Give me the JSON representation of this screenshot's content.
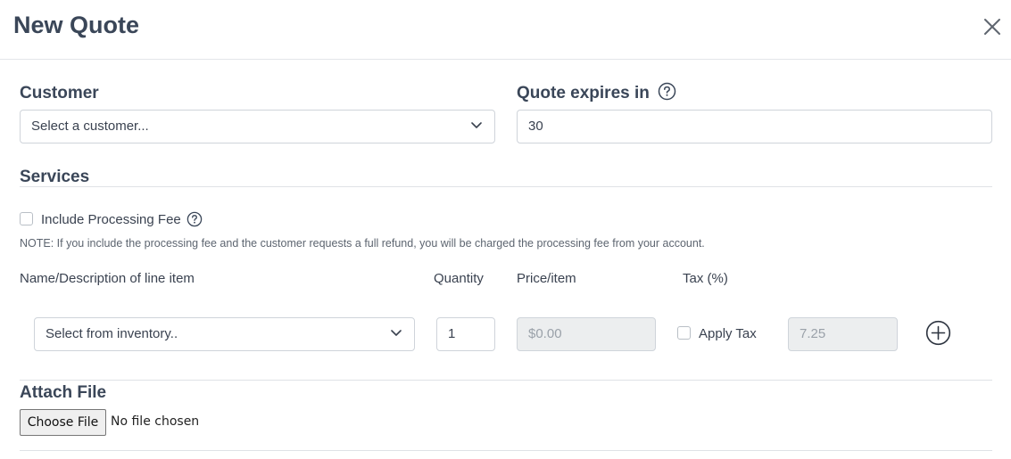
{
  "header": {
    "title": "New Quote",
    "close_icon": "close-icon"
  },
  "customer": {
    "label": "Customer",
    "select_value": "Select a customer..."
  },
  "expires": {
    "label": "Quote expires in",
    "value": "30",
    "help_icon": "question-circle-icon"
  },
  "services": {
    "heading": "Services",
    "include_fee_label": "Include Processing Fee",
    "include_fee_checked": false,
    "note": "NOTE: If you include the processing fee and the customer requests a full refund, you will be charged the processing fee from your account."
  },
  "line_items": {
    "columns": {
      "name": "Name/Description of line item",
      "quantity": "Quantity",
      "price": "Price/item",
      "tax": "Tax (%)"
    },
    "row": {
      "inventory_select": "Select from inventory..",
      "quantity": "1",
      "price_placeholder": "$0.00",
      "apply_tax_label": "Apply Tax",
      "apply_tax_checked": false,
      "tax_value": "7.25"
    },
    "add_icon": "plus-circle-icon"
  },
  "attach": {
    "heading": "Attach File",
    "button_label": "Choose File",
    "status": "No file chosen"
  }
}
